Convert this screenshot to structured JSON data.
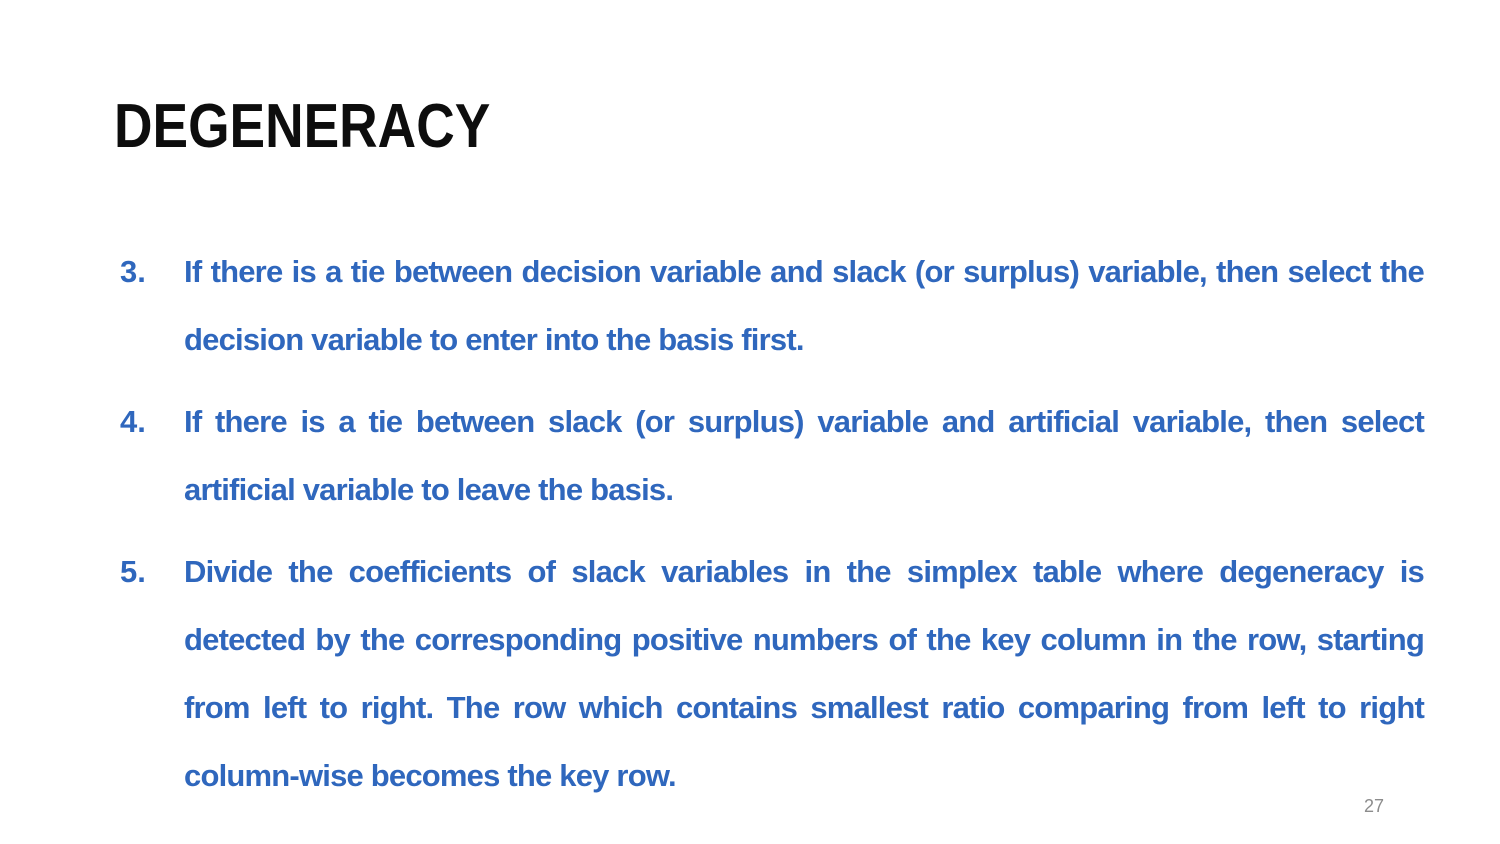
{
  "slide": {
    "title": "DEGENERACY",
    "page_number": "27",
    "points": [
      {
        "number": "3.",
        "text": "If there is a tie between decision variable and slack (or surplus) variable, then select the decision variable to enter into the basis first."
      },
      {
        "number": "4.",
        "text": "If there is a tie between slack (or surplus) variable and artificial variable, then select artificial variable to leave the basis."
      },
      {
        "number": "5.",
        "text": "Divide the coefficients of slack variables in the simplex table where degeneracy is detected by the corresponding positive numbers of the key column in the row, starting from left to right. The row which contains smallest ratio comparing from left to right column-wise becomes the key row."
      }
    ]
  }
}
